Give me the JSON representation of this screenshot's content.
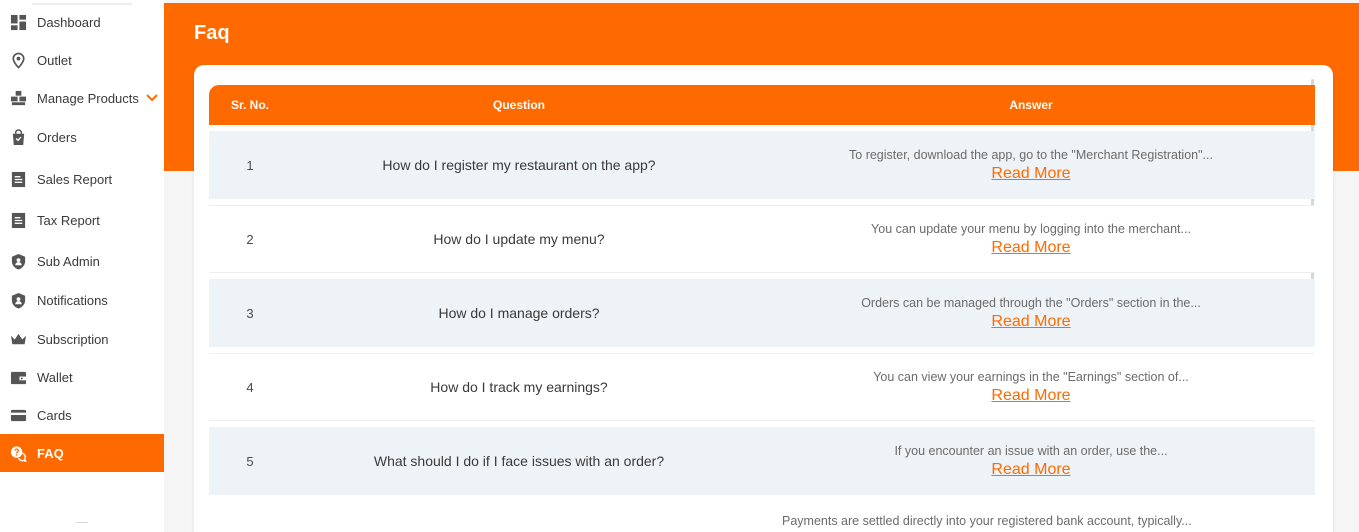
{
  "sidebar": {
    "items": [
      {
        "label": "Dashboard",
        "icon": "dashboard-icon"
      },
      {
        "label": "Outlet",
        "icon": "location-pin-icon"
      },
      {
        "label": "Manage Products",
        "icon": "boxes-icon"
      },
      {
        "label": "Orders",
        "icon": "shopping-bag-icon"
      },
      {
        "label": "Sales Report",
        "icon": "report-icon"
      },
      {
        "label": "Tax Report",
        "icon": "report-icon"
      },
      {
        "label": "Sub Admin",
        "icon": "user-shield-icon"
      },
      {
        "label": "Notifications",
        "icon": "user-shield-icon"
      },
      {
        "label": "Subscription",
        "icon": "crown-icon"
      },
      {
        "label": "Wallet",
        "icon": "wallet-icon"
      },
      {
        "label": "Cards",
        "icon": "card-icon"
      },
      {
        "label": "FAQ",
        "icon": "faq-chat-icon"
      }
    ],
    "active": "FAQ"
  },
  "page": {
    "title": "Faq"
  },
  "table": {
    "headers": {
      "no": "Sr. No.",
      "question": "Question",
      "answer": "Answer"
    },
    "read_more": "Read More",
    "rows": [
      {
        "no": "1",
        "question": "How do I register my restaurant on the app?",
        "answer": "To register, download the app, go to the \"Merchant Registration\"..."
      },
      {
        "no": "2",
        "question": "How do I update my menu?",
        "answer": "You can update your menu by logging into the merchant..."
      },
      {
        "no": "3",
        "question": "How do I manage orders?",
        "answer": "Orders can be managed through the \"Orders\" section in the..."
      },
      {
        "no": "4",
        "question": "How do I track my earnings?",
        "answer": "You can view your earnings in the \"Earnings\" section of..."
      },
      {
        "no": "5",
        "question": "What should I do if I face issues with an order?",
        "answer": "If you encounter an issue with an order, use the..."
      }
    ],
    "partial_row_answer": "Payments are settled directly into your registered bank account, typically..."
  },
  "colors": {
    "accent": "#ff6a00",
    "row_shade": "#eef3f8",
    "text": "#3a3a3a"
  }
}
